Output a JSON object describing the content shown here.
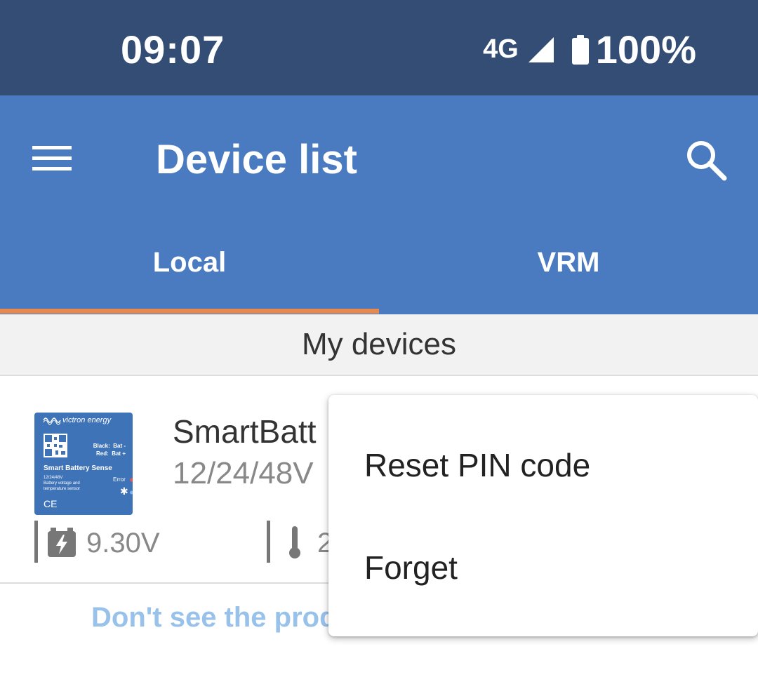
{
  "status_bar": {
    "time": "09:07",
    "network": "4G",
    "battery_percent": "100%"
  },
  "app_bar": {
    "title": "Device list",
    "menu_icon": "hamburger-menu-icon",
    "search_icon": "search-icon"
  },
  "tabs": [
    {
      "label": "Local",
      "selected": true
    },
    {
      "label": "VRM",
      "selected": false
    }
  ],
  "colors": {
    "status_bar": "#344d74",
    "app_bar": "#4a7ac0",
    "tab_indicator": "#e88a4e",
    "link": "#99c2ea"
  },
  "section": {
    "title": "My devices"
  },
  "device": {
    "name": "SmartBatt",
    "voltage_rating": "12/24/48V",
    "battery_voltage": "9.30V",
    "temperature": "2",
    "thumbnail": {
      "brand": "victron energy",
      "pins": "Black:  Bat -\nRed:  Bat +",
      "product_name": "Smart Battery Sense",
      "description": "12/24/48V\nBattery voltage and\ntemperature sensor",
      "error_label": "Error",
      "ce_mark": "CE"
    }
  },
  "help_link": {
    "text": "Don't see the prod"
  },
  "context_menu": {
    "items": [
      {
        "label": "Reset PIN code"
      },
      {
        "label": "Forget"
      }
    ]
  }
}
